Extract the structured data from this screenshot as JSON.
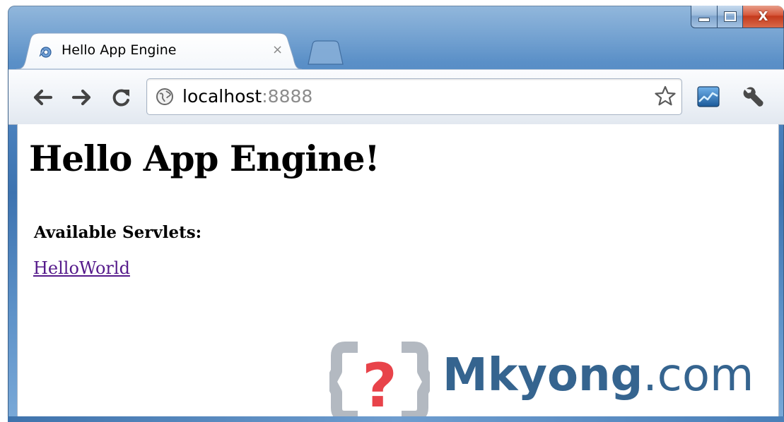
{
  "window": {
    "title_bar": {
      "minimize_icon": "minimize-icon",
      "maximize_icon": "maximize-icon",
      "close_glyph": "X"
    }
  },
  "tabs": [
    {
      "title": "Hello App Engine",
      "favicon": "app-engine-icon",
      "close_glyph": "×",
      "active": true
    }
  ],
  "toolbar": {
    "back_icon": "back-arrow-icon",
    "forward_icon": "forward-arrow-icon",
    "reload_icon": "reload-icon",
    "address": {
      "host": "localhost",
      "port": ":8888",
      "site_icon": "globe-icon"
    },
    "bookmark_icon": "star-icon",
    "extension_icon": "chart-extension-icon",
    "menu_icon": "wrench-icon"
  },
  "page": {
    "heading": "Hello App Engine!",
    "subheading": "Available Servlets:",
    "links": [
      {
        "text": "HelloWorld"
      }
    ]
  },
  "watermark": {
    "logo_glyph": "?",
    "brand": "Mkyong",
    "tld": ".com"
  },
  "colors": {
    "frame": "#4f86c2",
    "link_visited": "#551a8b",
    "watermark": "#35648f",
    "watermark_accent": "#e8434a",
    "close_button": "#c43a1c"
  }
}
